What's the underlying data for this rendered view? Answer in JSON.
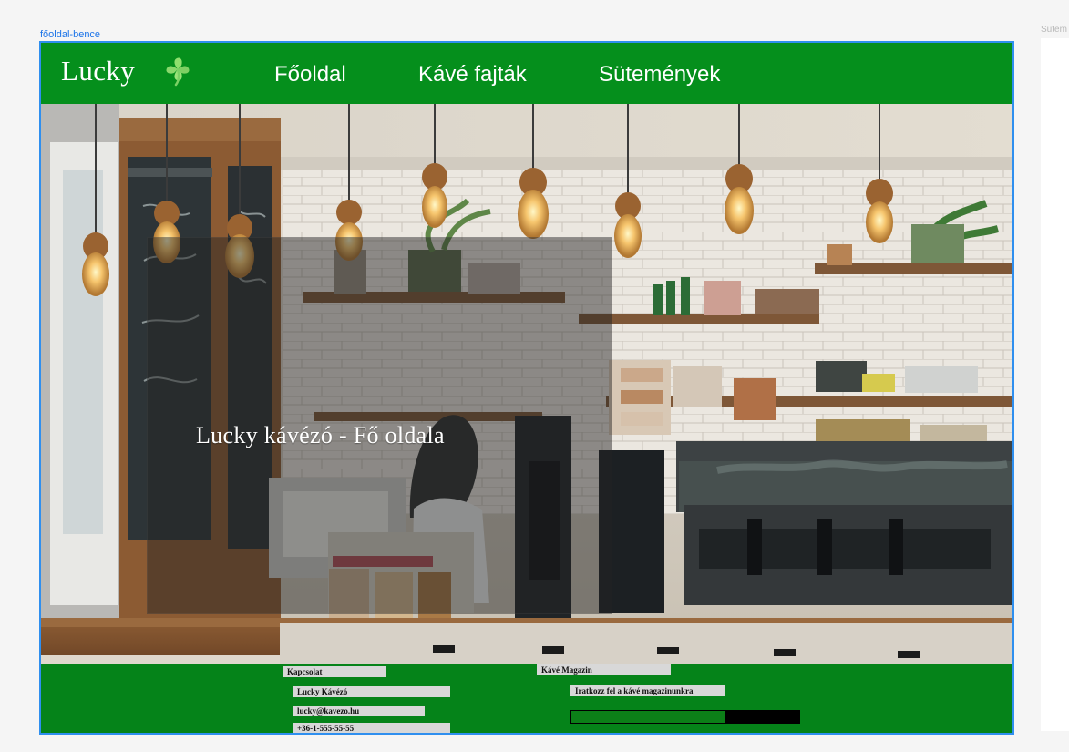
{
  "frame_label": "főoldal-bence",
  "side_frame_label": "Sütem",
  "navbar": {
    "logo": "Lucky",
    "clover_icon": "four-leaf-clover-icon",
    "items": [
      "Főoldal",
      "Kávé fajták",
      "Sütemények"
    ]
  },
  "hero": {
    "title": "Lucky kávézó  - Fő oldala"
  },
  "footer": {
    "contact_heading": "Kapcsolat",
    "contact_name": "Lucky Kávézó",
    "contact_email": "lucky@kavezo.hu",
    "contact_phone": "+36-1-555-55-55",
    "magazine_heading": "Kávé Magazin",
    "newsletter_text": "Iratkozz fel a kávé magazinunkra",
    "newsletter_input_value": "",
    "newsletter_button_label": ""
  },
  "colors": {
    "brand_green": "#058f1c",
    "footer_green": "#058319",
    "selection_blue": "#2f8fef"
  }
}
